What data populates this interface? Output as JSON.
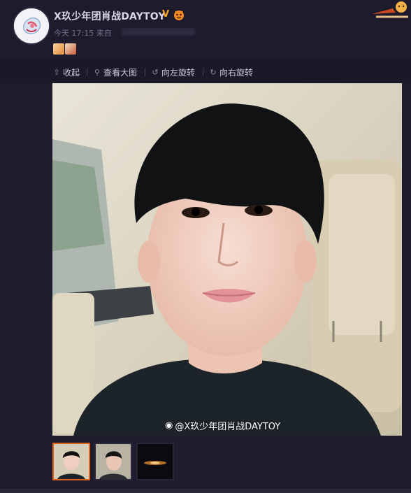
{
  "post": {
    "username": "X玖少年团肖战DAYTOY",
    "verified_mark": "V",
    "time": "今天 17:15",
    "source_prefix": "来自",
    "avatar_icon": "avatar-icon",
    "emoji_icons": [
      "emoji-sticker-1",
      "emoji-sticker-2"
    ]
  },
  "toolbar": {
    "collapse_label": "收起",
    "view_large_label": "查看大图",
    "rotate_left_label": "向左旋转",
    "rotate_right_label": "向右旋转",
    "collapse_icon": "up-arrow-icon",
    "view_large_icon": "magnifier-icon",
    "rotate_left_icon": "rotate-left-icon",
    "rotate_right_icon": "rotate-right-icon"
  },
  "image": {
    "watermark": "@X玖少年团肖战DAYTOY",
    "watermark_icon": "weibo-logo-icon"
  },
  "thumbnails": {
    "count": 3,
    "active_index": 0,
    "accent_color": "#e2651f"
  },
  "colors": {
    "background": "#1f1c2e",
    "username": "#d8d6e6",
    "meta": "#74708a",
    "verified": "#f5a623"
  }
}
